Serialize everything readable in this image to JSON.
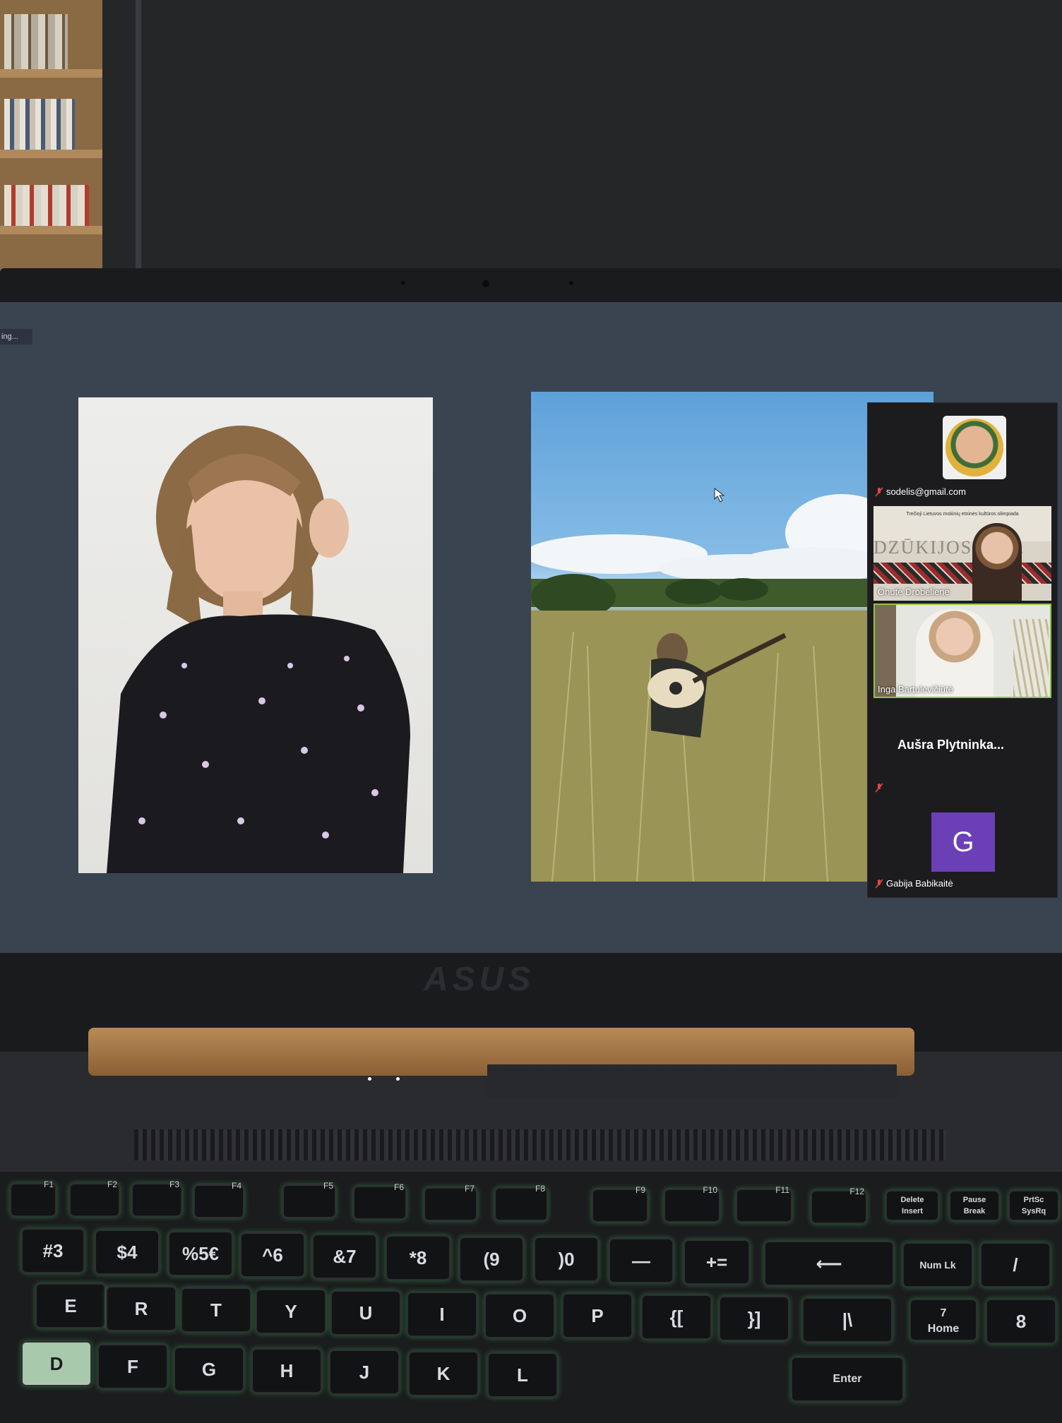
{
  "zoom": {
    "recording_label": "ing...",
    "participants": [
      {
        "name": "sodelis@gmail.com",
        "muted": true,
        "type": "avatar-photo"
      },
      {
        "name": "Onutė Drobelienė",
        "muted": false,
        "type": "video",
        "background_text_top": "Trečioji Lietuvos mokinių etninės kultūros olimpiada",
        "background_text_big": "DZŪKIJOS RA..."
      },
      {
        "name": "Inga Bartulevičiūtė",
        "muted": false,
        "type": "video"
      },
      {
        "name": "Aušra  Plytninka...",
        "muted": true,
        "type": "name-only"
      },
      {
        "name": "Gabija Babikaitė",
        "muted": true,
        "type": "initial",
        "initial": "G",
        "initial_color": "#6b3fb6"
      }
    ]
  },
  "laptop": {
    "brand": "ASUS"
  },
  "keyboard": {
    "fn_row": [
      "F1",
      "F2",
      "F3",
      "F4",
      "F5",
      "F6",
      "F7",
      "F8",
      "F9",
      "F10",
      "F11",
      "F12"
    ],
    "fn_row_extra": [
      "Delete\nInsert",
      "Pause\nBreak",
      "PrtSc\nSysRq"
    ],
    "number_row": [
      "#3",
      "$4",
      "%5€",
      "^6",
      "&7",
      "*8",
      "(9",
      ")0",
      "—",
      "+=",
      "⟵",
      "Num Lk",
      "/"
    ],
    "letter_row": [
      "E",
      "R",
      "T",
      "Y",
      "U",
      "I",
      "O",
      "P",
      "{[",
      "}]",
      "|\\",
      "7\nHome",
      "8"
    ],
    "bottom_row": [
      "D",
      "F",
      "G",
      "H",
      "J",
      "K",
      "L",
      "Enter"
    ]
  }
}
